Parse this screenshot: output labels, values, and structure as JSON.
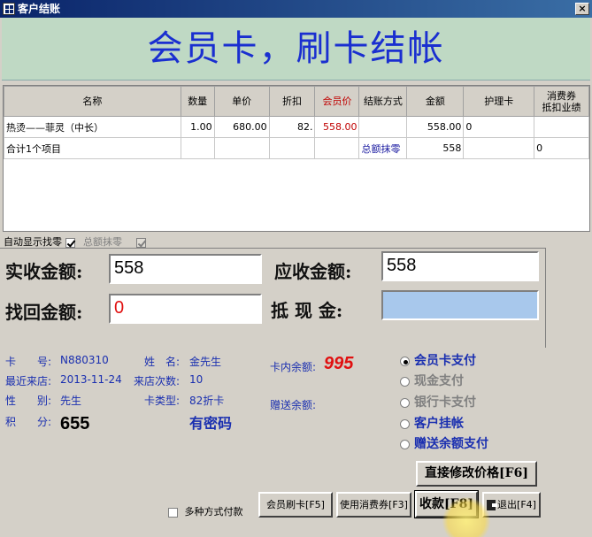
{
  "window": {
    "title": "客户结账",
    "close_glyph": "×"
  },
  "banner": {
    "text": "会员卡，刷卡结帐"
  },
  "table": {
    "headers": [
      "名称",
      "数量",
      "单价",
      "折扣",
      "会员价",
      "结账方式",
      "金额",
      "护理卡",
      "消费券\n抵扣业绩"
    ],
    "row1": {
      "name": "热烫——菲灵（中长）",
      "qty": "1.00",
      "price": "680.00",
      "discount": "82.",
      "member_price": "558.00",
      "method": "",
      "amount": "558.00",
      "care_card": "0",
      "voucher": ""
    },
    "row2": {
      "name": "合计1个项目",
      "method": "总额抹零",
      "amount": "558",
      "voucher": "0"
    }
  },
  "options": {
    "auto_change_label": "自动显示找零",
    "auto_change_checked": true,
    "round_total_label": "总额抹零",
    "round_total_checked": true
  },
  "amounts": {
    "actual_label": "实收金额:",
    "actual_value": "558",
    "due_label": "应收金额:",
    "due_value": "558",
    "change_label": "找回金额:",
    "change_value": "0",
    "offset_label": "抵 现 金:",
    "offset_value": ""
  },
  "member": {
    "card_no_label": "卡　　号:",
    "card_no": "N880310",
    "name_label": "姓　名:",
    "name": "金先生",
    "last_visit_label": "最近来店:",
    "last_visit": "2013-11-24",
    "visits_label": "来店次数:",
    "visits": "10",
    "gender_label": "性　　别:",
    "gender": "先生",
    "card_type_label": "卡类型:",
    "card_type": "82折卡",
    "points_label": "积　　分:",
    "points": "655",
    "password_text": "有密码",
    "card_balance_label": "卡内余额:",
    "card_balance": "995",
    "gift_balance_label": "赠送余额:"
  },
  "payment": [
    {
      "label": "会员卡支付",
      "selected": true,
      "enabled": true
    },
    {
      "label": "现金支付",
      "selected": false,
      "enabled": false
    },
    {
      "label": "银行卡支付",
      "selected": false,
      "enabled": false
    },
    {
      "label": "客户挂帐",
      "selected": false,
      "enabled": true
    },
    {
      "label": "赠送余额支付",
      "selected": false,
      "enabled": true
    }
  ],
  "buttons": {
    "modify_price": "直接修改价格[F6]",
    "multi_pay": "多种方式付款",
    "member_swipe": "会员刷卡[F5]",
    "use_voucher": "使用消费券[F3]",
    "collect": "收款[F8]",
    "exit": "退出[F4]"
  }
}
